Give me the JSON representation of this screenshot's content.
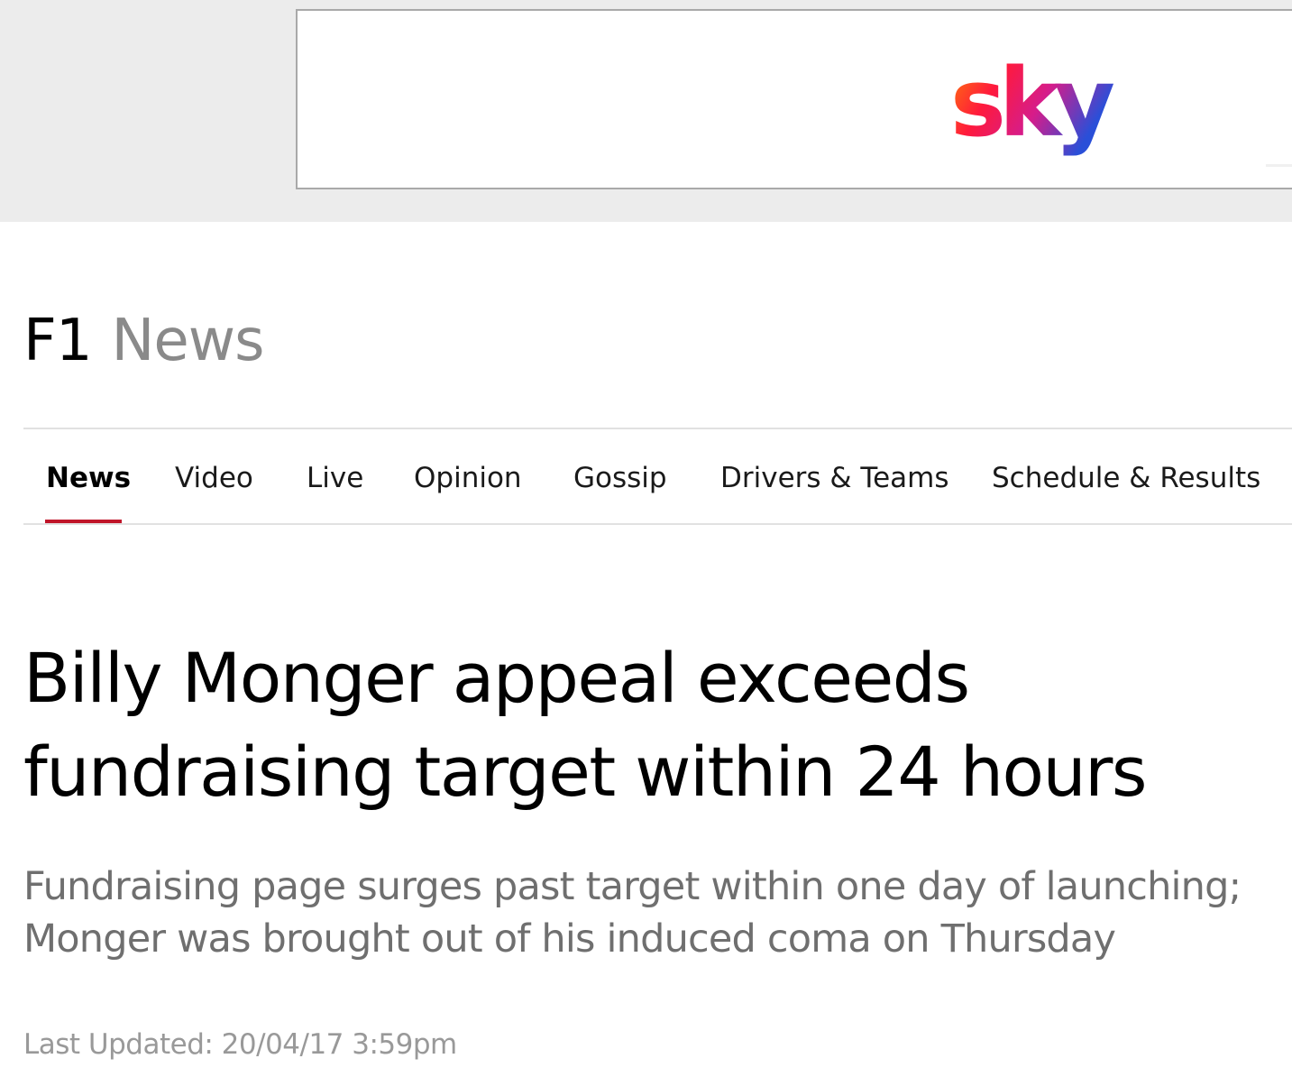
{
  "advert": {
    "logo_text": "sky",
    "logo_name": "sky-logo"
  },
  "section": {
    "title_part1": "F1",
    "title_part2": "News"
  },
  "nav": {
    "items": [
      {
        "label": "News",
        "active": true
      },
      {
        "label": "Video"
      },
      {
        "label": "Live"
      },
      {
        "label": "Opinion"
      },
      {
        "label": "Gossip"
      },
      {
        "label": "Drivers & Teams"
      },
      {
        "label": "Schedule & Results"
      }
    ],
    "active_color": "#c0152a"
  },
  "article": {
    "headline": "Billy Monger appeal exceeds fundraising target within 24 hours",
    "standfirst": "Fundraising page surges past target within one day of launching; Monger was brought out of his induced coma on Thursday",
    "last_updated": "Last Updated: 20/04/17 3:59pm"
  }
}
